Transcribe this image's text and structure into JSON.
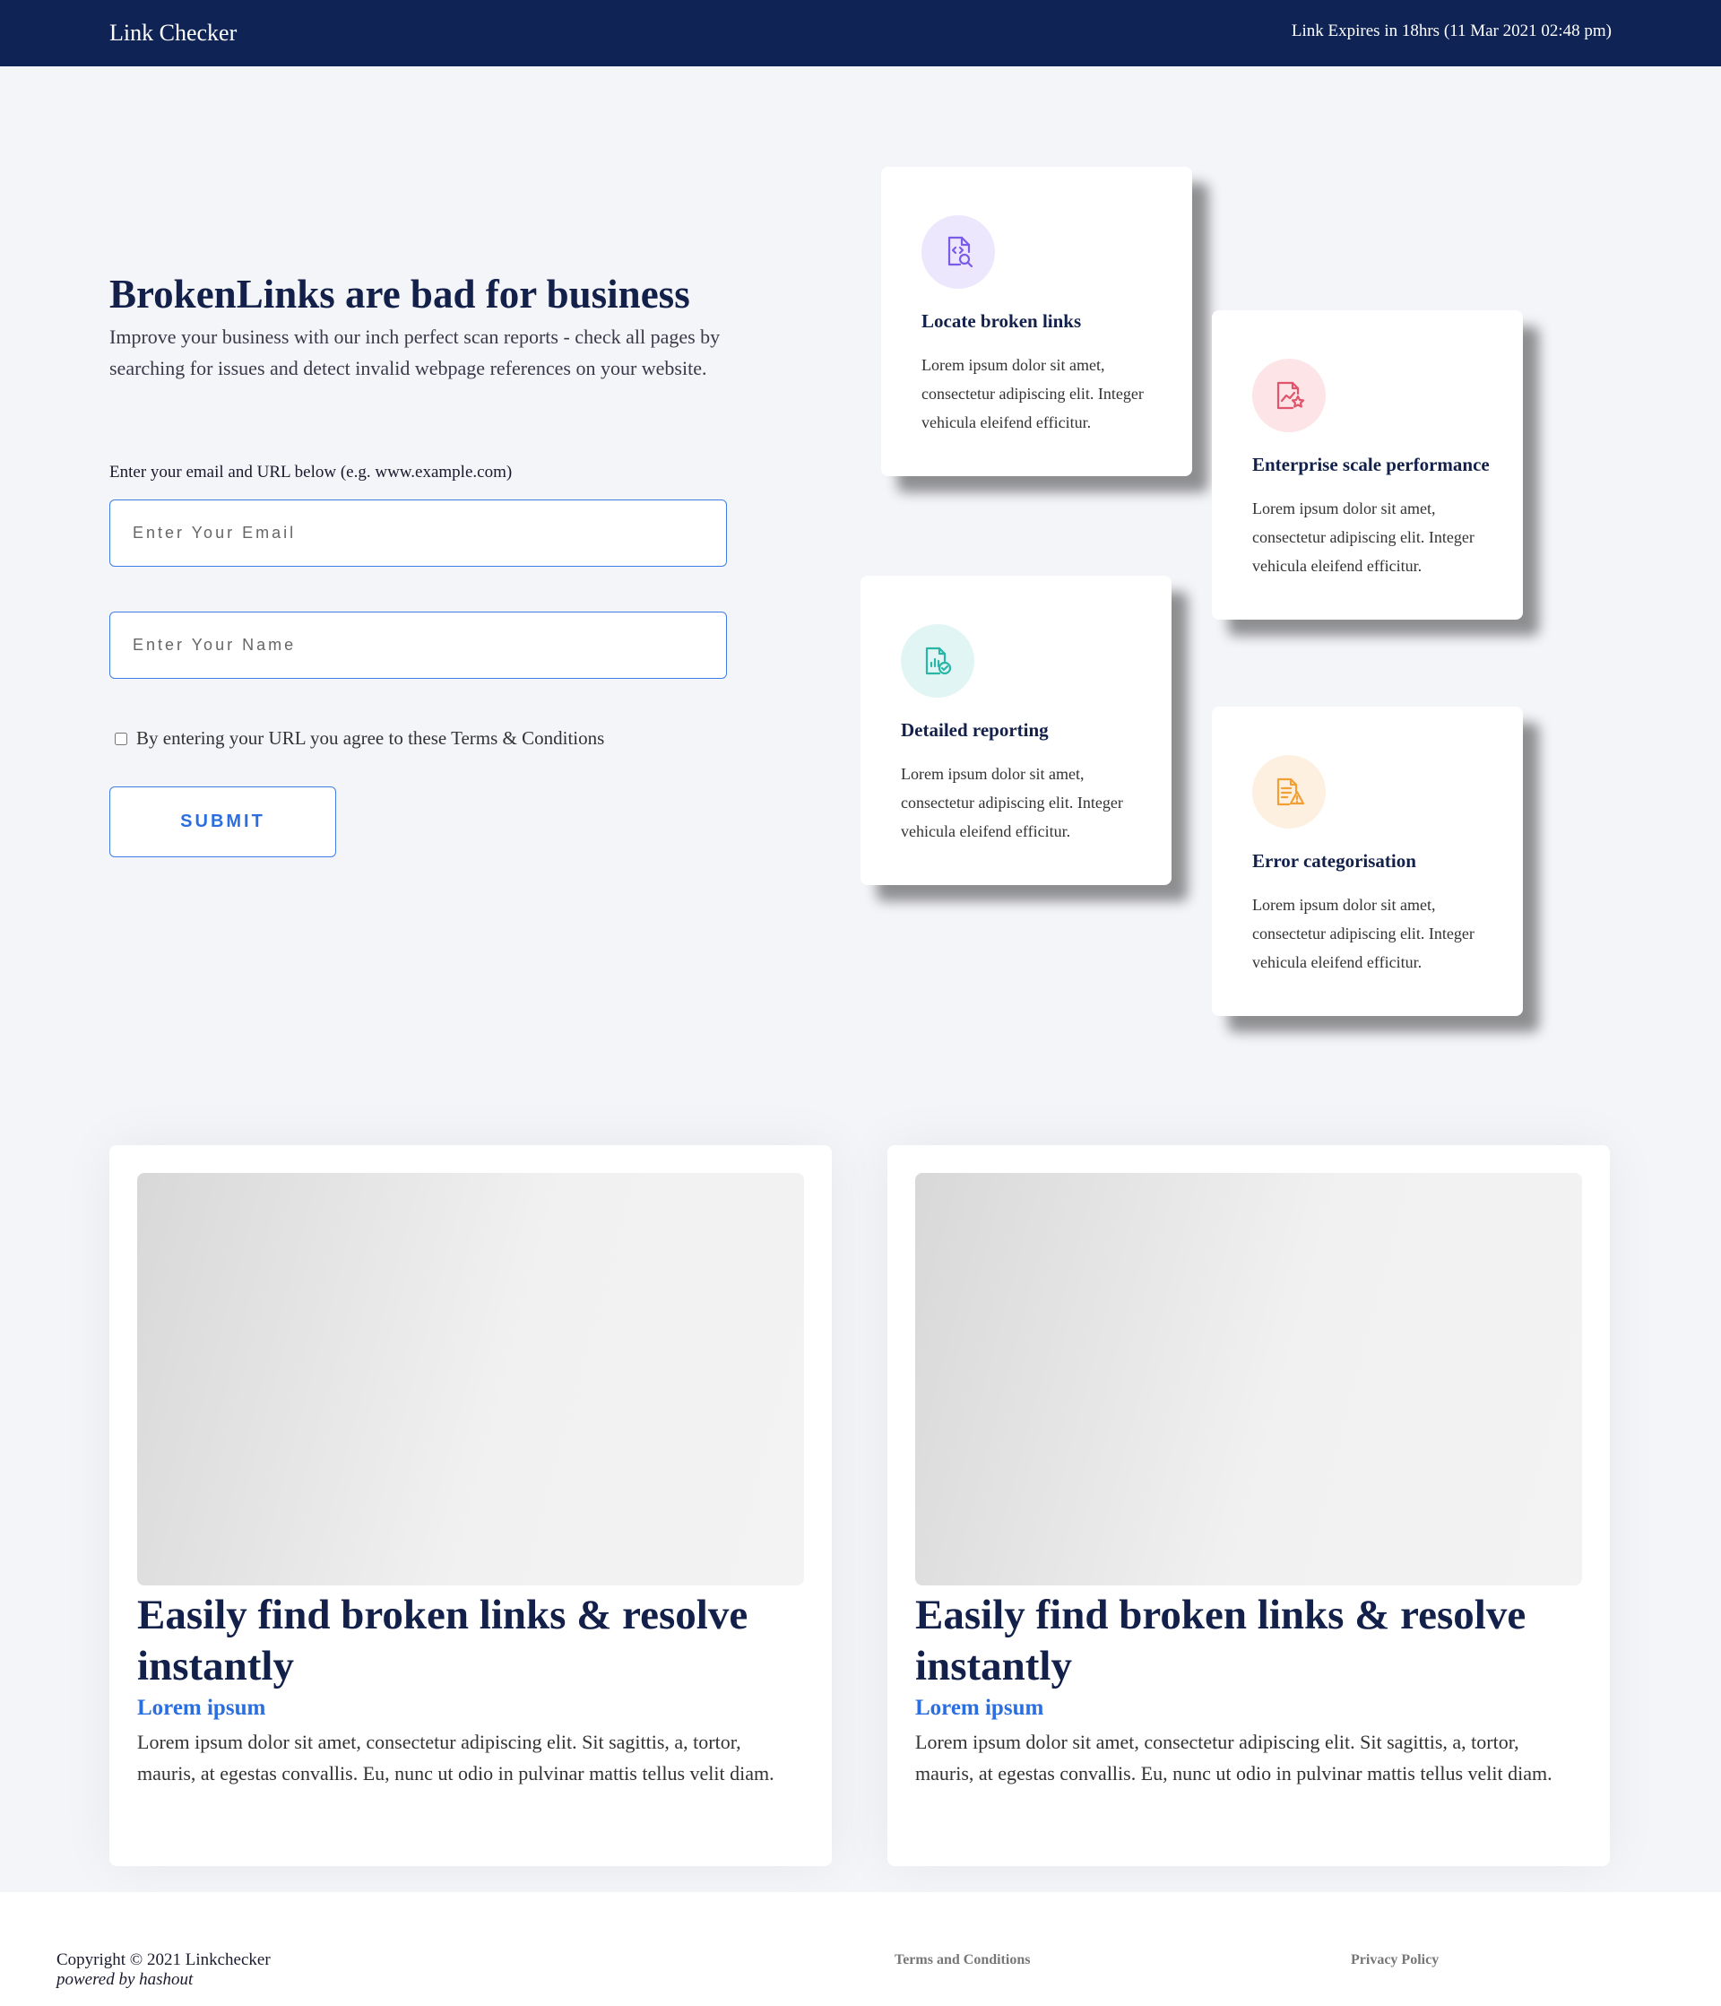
{
  "header": {
    "brand": "Link Checker",
    "expiry": "Link Expires in 18hrs (11 Mar 2021 02:48 pm)"
  },
  "hero": {
    "title": "BrokenLinks are bad for business",
    "description": "Improve your business with our inch perfect scan reports - check all pages by searching for issues and detect invalid webpage references on your website."
  },
  "form": {
    "label": "Enter your email and URL below (e.g. www.example.com)",
    "email_placeholder": "Enter Your Email",
    "name_placeholder": "Enter Your Name",
    "terms_label": "By entering your URL you agree to these Terms & Conditions",
    "submit_label": "SUBMIT"
  },
  "features": [
    {
      "icon": "code-search-icon",
      "accent": "#7b5ce6",
      "title": "Locate broken links",
      "description": "Lorem ipsum dolor sit amet, consectetur adipiscing elit. Integer vehicula eleifend efficitur."
    },
    {
      "icon": "chart-star-icon",
      "accent": "#e0556b",
      "title": "Enterprise scale performance",
      "description": "Lorem ipsum dolor sit amet, consectetur adipiscing elit. Integer vehicula eleifend efficitur."
    },
    {
      "icon": "report-check-icon",
      "accent": "#2bb5a7",
      "title": "Detailed reporting",
      "description": "Lorem ipsum dolor sit amet, consectetur adipiscing elit. Integer vehicula eleifend efficitur."
    },
    {
      "icon": "document-warning-icon",
      "accent": "#f0a035",
      "title": "Error categorisation",
      "description": "Lorem ipsum dolor sit amet, consectetur adipiscing elit. Integer vehicula eleifend efficitur."
    }
  ],
  "cards": [
    {
      "title": "Easily find broken links & resolve instantly",
      "subtitle": "Lorem ipsum",
      "description": "Lorem ipsum dolor sit amet, consectetur adipiscing elit. Sit sagittis, a, tortor, mauris, at egestas convallis. Eu, nunc ut odio in pulvinar mattis tellus velit diam."
    },
    {
      "title": "Easily find broken links & resolve instantly",
      "subtitle": "Lorem ipsum",
      "description": "Lorem ipsum dolor sit amet, consectetur adipiscing elit. Sit sagittis, a, tortor, mauris, at egestas convallis. Eu, nunc ut odio in pulvinar mattis tellus velit diam."
    }
  ],
  "footer": {
    "copyright": "Copyright © 2021 Linkchecker",
    "powered": "powered by hashout",
    "terms_link": "Terms and Conditions",
    "privacy_link": "Privacy Policy"
  }
}
